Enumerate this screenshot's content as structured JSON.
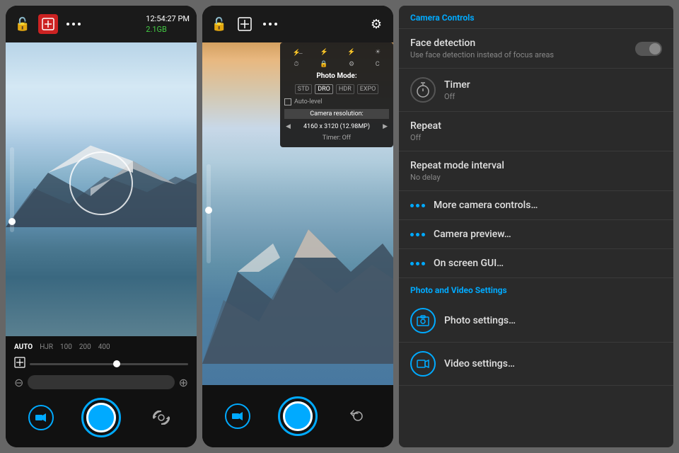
{
  "phone1": {
    "header": {
      "unlock_icon": "🔓",
      "exposure_icon": "⊞",
      "more_icon": "⋯",
      "time": "12:54:27 PM",
      "storage": "2.1GB"
    },
    "iso_options": [
      "AUTO",
      "HJR",
      "100",
      "200",
      "400"
    ],
    "iso_selected": "AUTO",
    "camera_buttons": {
      "video_icon": "▶",
      "capture_label": "capture",
      "switch_icon": "↺"
    }
  },
  "phone2": {
    "header": {
      "unlock_icon": "🔓",
      "exposure_icon": "⊞",
      "more_icon": "⋯",
      "settings_icon": "⚙"
    },
    "popup": {
      "title": "Photo Mode:",
      "modes": [
        "STD",
        "DRO",
        "HDR",
        "EXPO"
      ],
      "auto_level": "Auto-level",
      "section_resolution": "Camera resolution:",
      "resolution": "4160 x 3120 (12.98MP)",
      "timer": "Timer: Off"
    }
  },
  "controls": {
    "header_label": "Camera Controls",
    "items": [
      {
        "id": "face-detection",
        "title": "Face detection",
        "subtitle": "Use face detection instead of focus areas",
        "type": "toggle",
        "value": false
      },
      {
        "id": "timer",
        "title": "Timer",
        "subtitle": "Off",
        "type": "icon",
        "icon": "⏱"
      },
      {
        "id": "repeat",
        "title": "Repeat",
        "subtitle": "Off",
        "type": "text"
      },
      {
        "id": "repeat-mode-interval",
        "title": "Repeat mode interval",
        "subtitle": "No delay",
        "type": "text"
      },
      {
        "id": "more-camera-controls",
        "title": "More camera controls…",
        "type": "dots"
      },
      {
        "id": "camera-preview",
        "title": "Camera preview…",
        "type": "dots"
      },
      {
        "id": "on-screen-gui",
        "title": "On screen GUI…",
        "type": "dots"
      }
    ],
    "photo_video_section": "Photo and Video Settings",
    "photo_video_items": [
      {
        "id": "photo-settings",
        "title": "Photo settings…",
        "icon": "📷",
        "type": "cyan-icon"
      },
      {
        "id": "video-settings",
        "title": "Video settings…",
        "icon": "🎥",
        "type": "cyan-icon"
      }
    ]
  }
}
